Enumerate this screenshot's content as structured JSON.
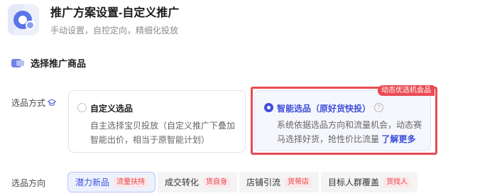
{
  "header": {
    "title": "推广方案设置-自定义推广",
    "subtitle": "手动设置，自控定向，精细化投放"
  },
  "section": {
    "title": "选择推广商品"
  },
  "selection_method": {
    "label": "选品方式",
    "options": [
      {
        "title": "自定义选品",
        "desc": "自主选择宝贝投放（自定义推广下叠加智能出价，相当于原智能计划）",
        "selected": false
      },
      {
        "title": "智能选品（原好货快投）",
        "desc": "系统依据选品方向和流量机会，动态赛马选择好货，抢性价比流量",
        "link": "了解更多",
        "badge": "动态优选机会品",
        "selected": true
      }
    ]
  },
  "direction": {
    "label": "选品方向",
    "tabs": [
      {
        "label": "潜力新品",
        "tag": "流量扶持",
        "active": true
      },
      {
        "label": "成交转化",
        "tag": "货自身",
        "active": false
      },
      {
        "label": "店铺引流",
        "tag": "货带店",
        "active": false
      },
      {
        "label": "目标人群覆盖",
        "tag": "货找人",
        "active": false
      }
    ]
  },
  "colors": {
    "accent": "#3d4fd8",
    "highlight_frame": "#ea4b55",
    "tag_text": "#e8434c"
  }
}
